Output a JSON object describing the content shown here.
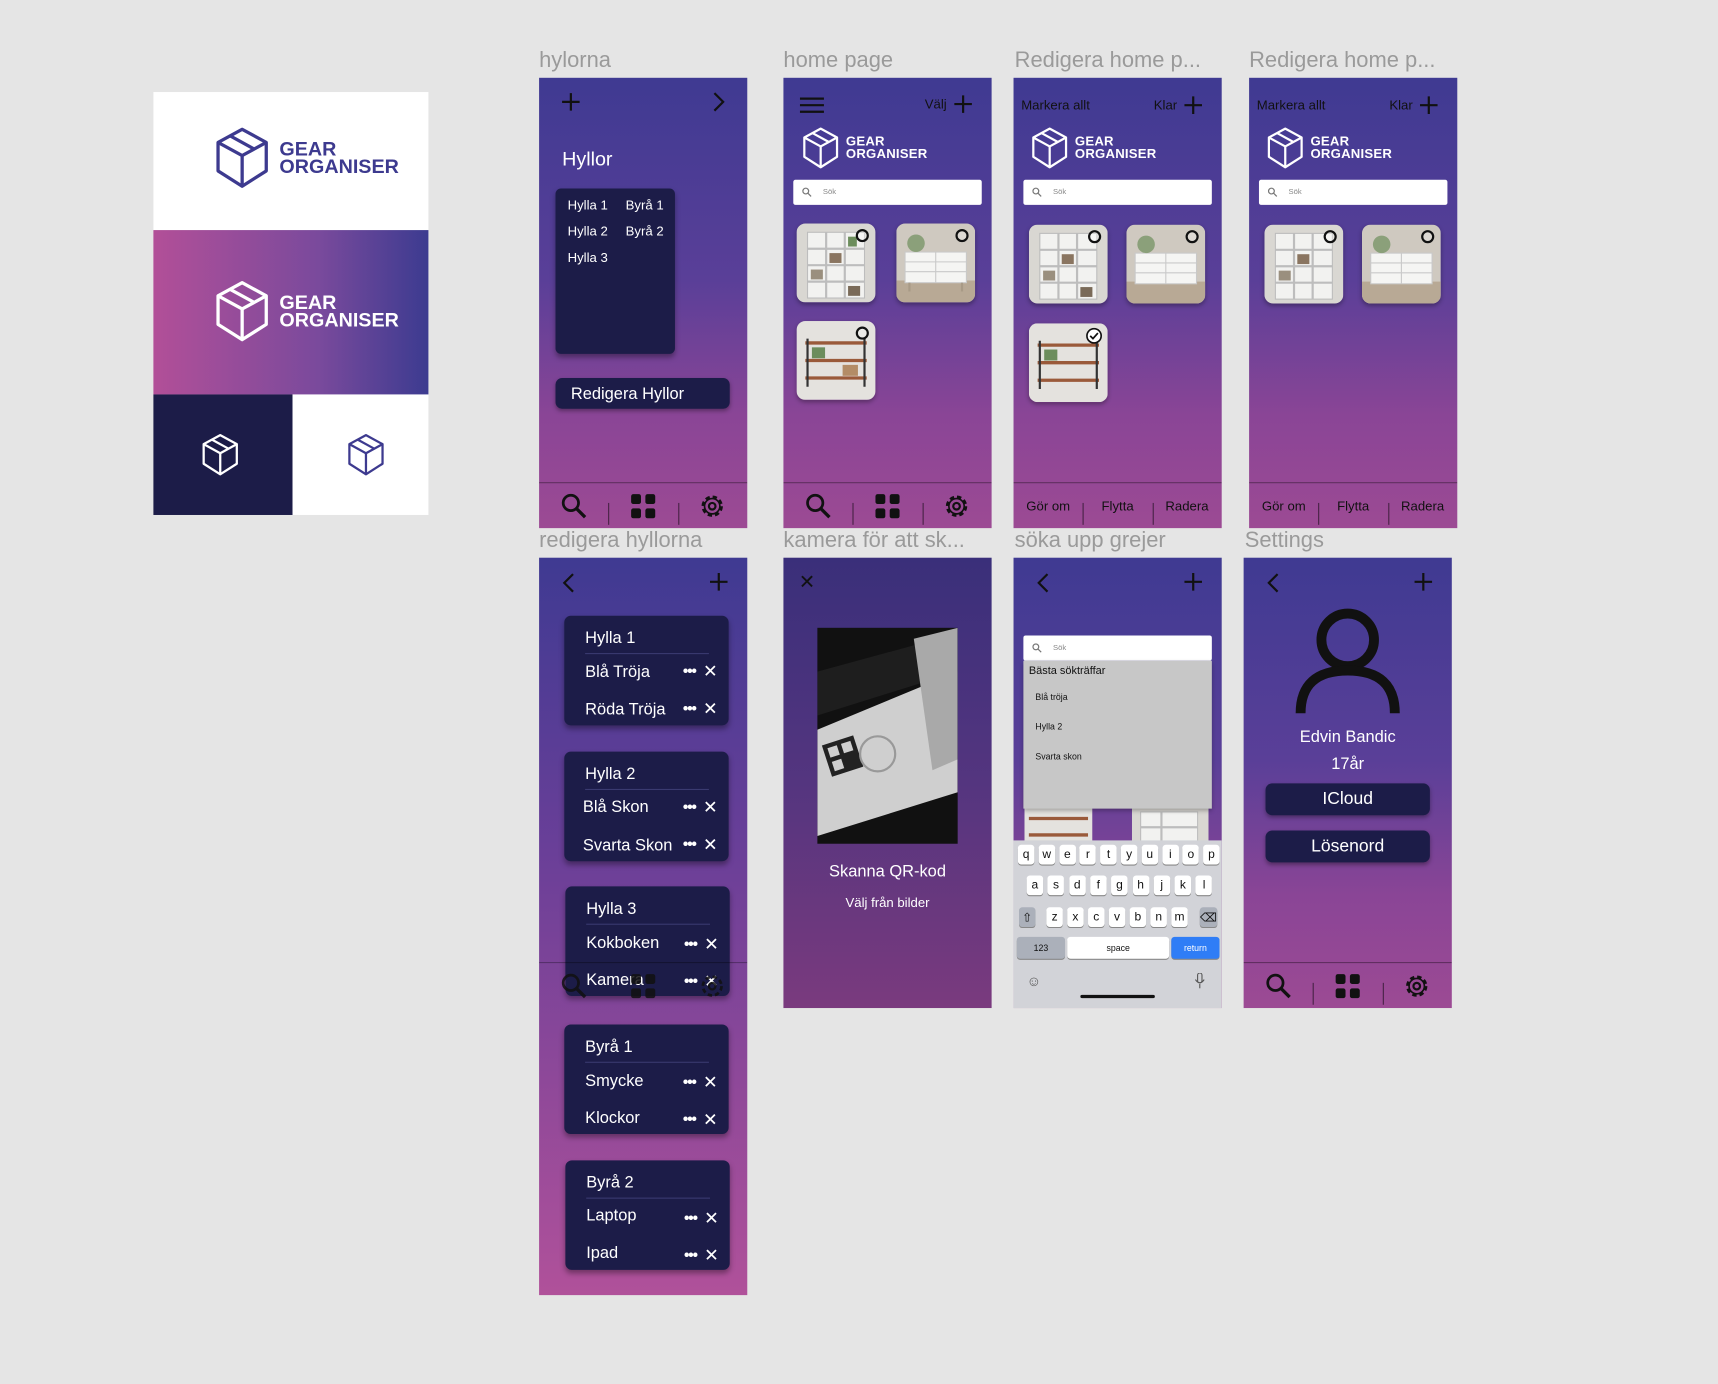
{
  "brand": {
    "line1": "GEAR",
    "line2": "ORGANISER",
    "primary": "#3d3a8f",
    "dark": "#1c1c48",
    "gradient_from": "#b24f98",
    "gradient_to": "#3c3b90"
  },
  "frames": {
    "hylorna": "hylorna",
    "home": "home page",
    "edit1": "Redigera home p...",
    "edit2": "Redigera home p...",
    "redigera": "redigera hyllorna",
    "kamera": "kamera för att sk...",
    "soka": "söka upp grejer",
    "settings": "Settings"
  },
  "hyllor": {
    "title": "Hyllor",
    "list": [
      {
        "a": "Hylla 1",
        "b": "Byrå 1"
      },
      {
        "a": "Hylla 2",
        "b": "Byrå 2"
      },
      {
        "a": "Hylla 3",
        "b": ""
      }
    ],
    "edit_button": "Redigera Hyllor"
  },
  "home": {
    "select": "Välj",
    "search_placeholder": "Sök"
  },
  "edit": {
    "select_all": "Markera allt",
    "done": "Klar",
    "undo": "Gör om",
    "move": "Flytta",
    "delete": "Radera"
  },
  "shelves": [
    {
      "name": "Hylla 1",
      "items": [
        "Blå Tröja",
        "Röda Tröja"
      ]
    },
    {
      "name": "Hylla 2",
      "items": [
        "Blå Skon",
        "Svarta Skon"
      ]
    },
    {
      "name": "Hylla 3",
      "items": [
        "Kokboken",
        "Kamera"
      ]
    },
    {
      "name": "Byrå 1",
      "items": [
        "Smycke",
        "Klockor"
      ]
    },
    {
      "name": "Byrå 2",
      "items": [
        "Laptop",
        "Ipad"
      ]
    }
  ],
  "camera": {
    "scan": "Skanna QR-kod",
    "from_pictures": "Välj från bilder"
  },
  "search": {
    "placeholder": "Sök",
    "best_header": "Bästa sökträffar",
    "results": [
      "Blå tröja",
      "Hylla 2",
      "Svarta skon"
    ],
    "keyboard": {
      "row1": [
        "q",
        "w",
        "e",
        "r",
        "t",
        "y",
        "u",
        "i",
        "o",
        "p"
      ],
      "row2": [
        "a",
        "s",
        "d",
        "f",
        "g",
        "h",
        "j",
        "k",
        "l"
      ],
      "row3": [
        "z",
        "x",
        "c",
        "v",
        "b",
        "n",
        "m"
      ],
      "num": "123",
      "space": "space",
      "return": "return"
    }
  },
  "profile": {
    "name": "Edvin Bandic",
    "age": "17år",
    "icloud": "ICloud",
    "password": "Lösenord"
  },
  "icons": [
    "plus-icon",
    "chevron-right-icon",
    "chevron-left-icon",
    "menu-icon",
    "search-icon",
    "grid-icon",
    "gear-icon",
    "close-icon",
    "user-icon",
    "box-icon"
  ]
}
